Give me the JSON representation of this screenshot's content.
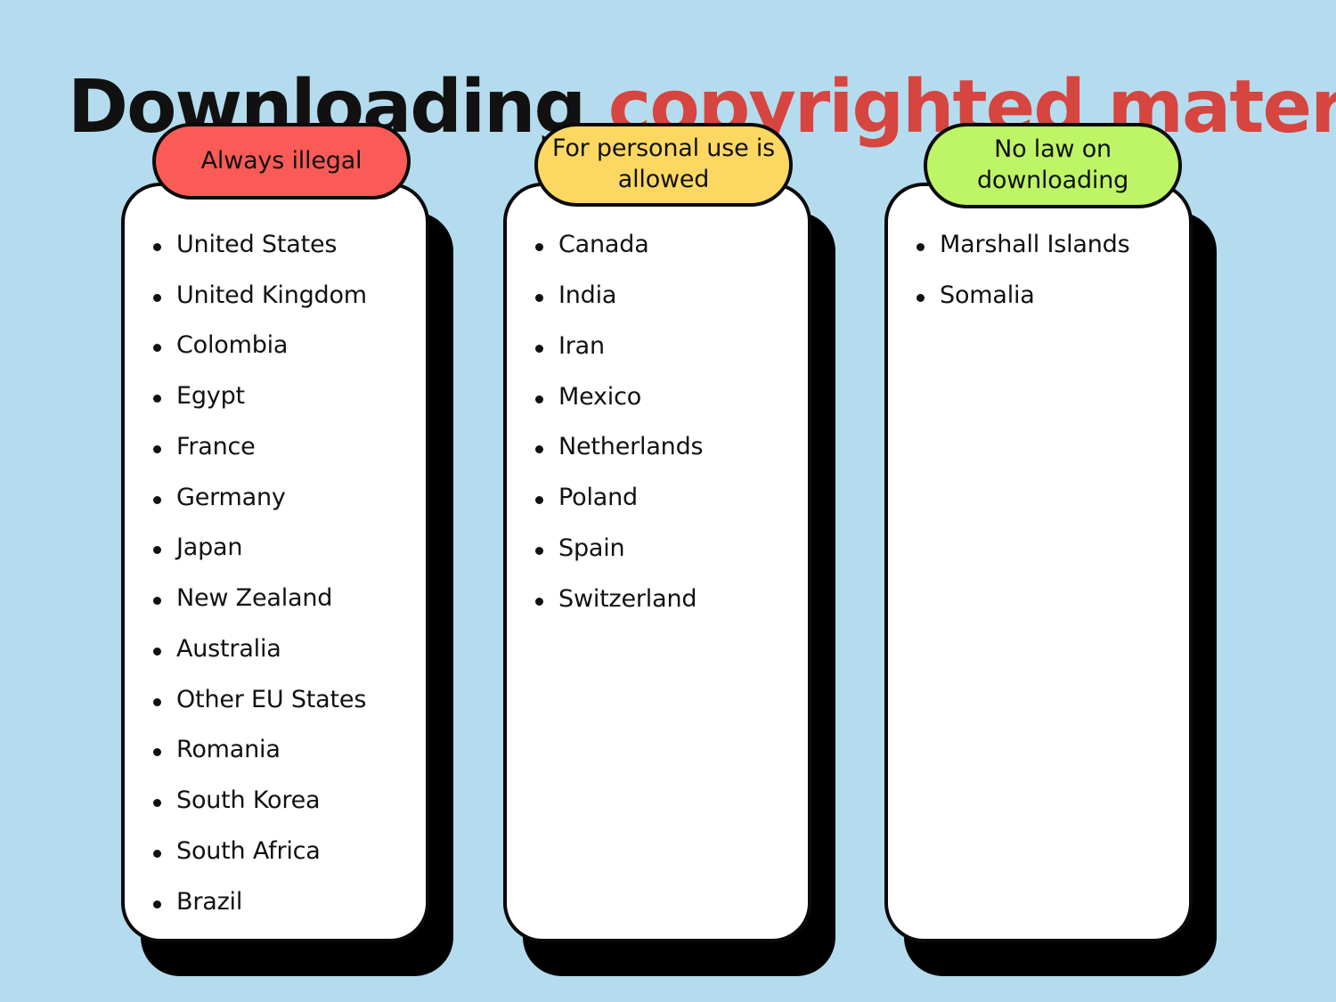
{
  "title": {
    "part_black": "Downloading ",
    "part_red": "copyrighted material",
    "accent_color": "#d6453f",
    "text_color": "#111111"
  },
  "background_color": "#b5dcee",
  "columns": [
    {
      "id": "always-illegal",
      "header": "Always illegal",
      "header_color": "#fa5b57",
      "items": [
        "United States",
        "United Kingdom",
        "Colombia",
        "Egypt",
        "France",
        "Germany",
        "Japan",
        "New Zealand",
        "Australia",
        "Other EU States",
        "Romania",
        "South Korea",
        "South Africa",
        "Brazil"
      ]
    },
    {
      "id": "personal-use-allowed",
      "header": "For personal use is allowed",
      "header_color": "#fcd862",
      "items": [
        "Canada",
        "India",
        "Iran",
        "Mexico",
        "Netherlands",
        "Poland",
        "Spain",
        "Switzerland"
      ]
    },
    {
      "id": "no-law-on-downloading",
      "header": "No law on downloading",
      "header_color": "#bdf566",
      "items": [
        "Marshall Islands",
        "Somalia"
      ]
    }
  ]
}
